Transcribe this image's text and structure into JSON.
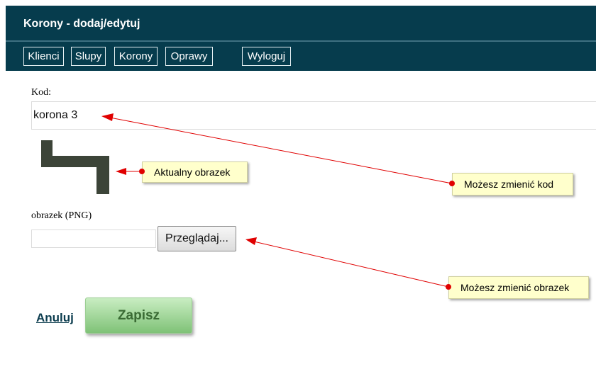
{
  "header": {
    "title": "Korony - dodaj/edytuj"
  },
  "nav": {
    "klienci": "Klienci",
    "slupy": "Slupy",
    "korony": "Korony",
    "oprawy": "Oprawy",
    "wyloguj": "Wyloguj"
  },
  "form": {
    "kod_label": "Kod:",
    "kod_value": "korona 3",
    "image_label": "obrazek (PNG)",
    "browse_label": "Przeglądaj...",
    "cancel_label": "Anuluj",
    "save_label": "Zapisz"
  },
  "annotations": {
    "current_image": "Aktualny obrazek",
    "change_code": "Możesz zmienić kod",
    "change_image": "Możesz zmienić obrazek"
  },
  "colors": {
    "header_bg": "#063c4d",
    "save_button": "#7fc277",
    "note_bg": "#ffffcc",
    "arrow": "#e00000",
    "crown_shape": "#3c4438"
  }
}
